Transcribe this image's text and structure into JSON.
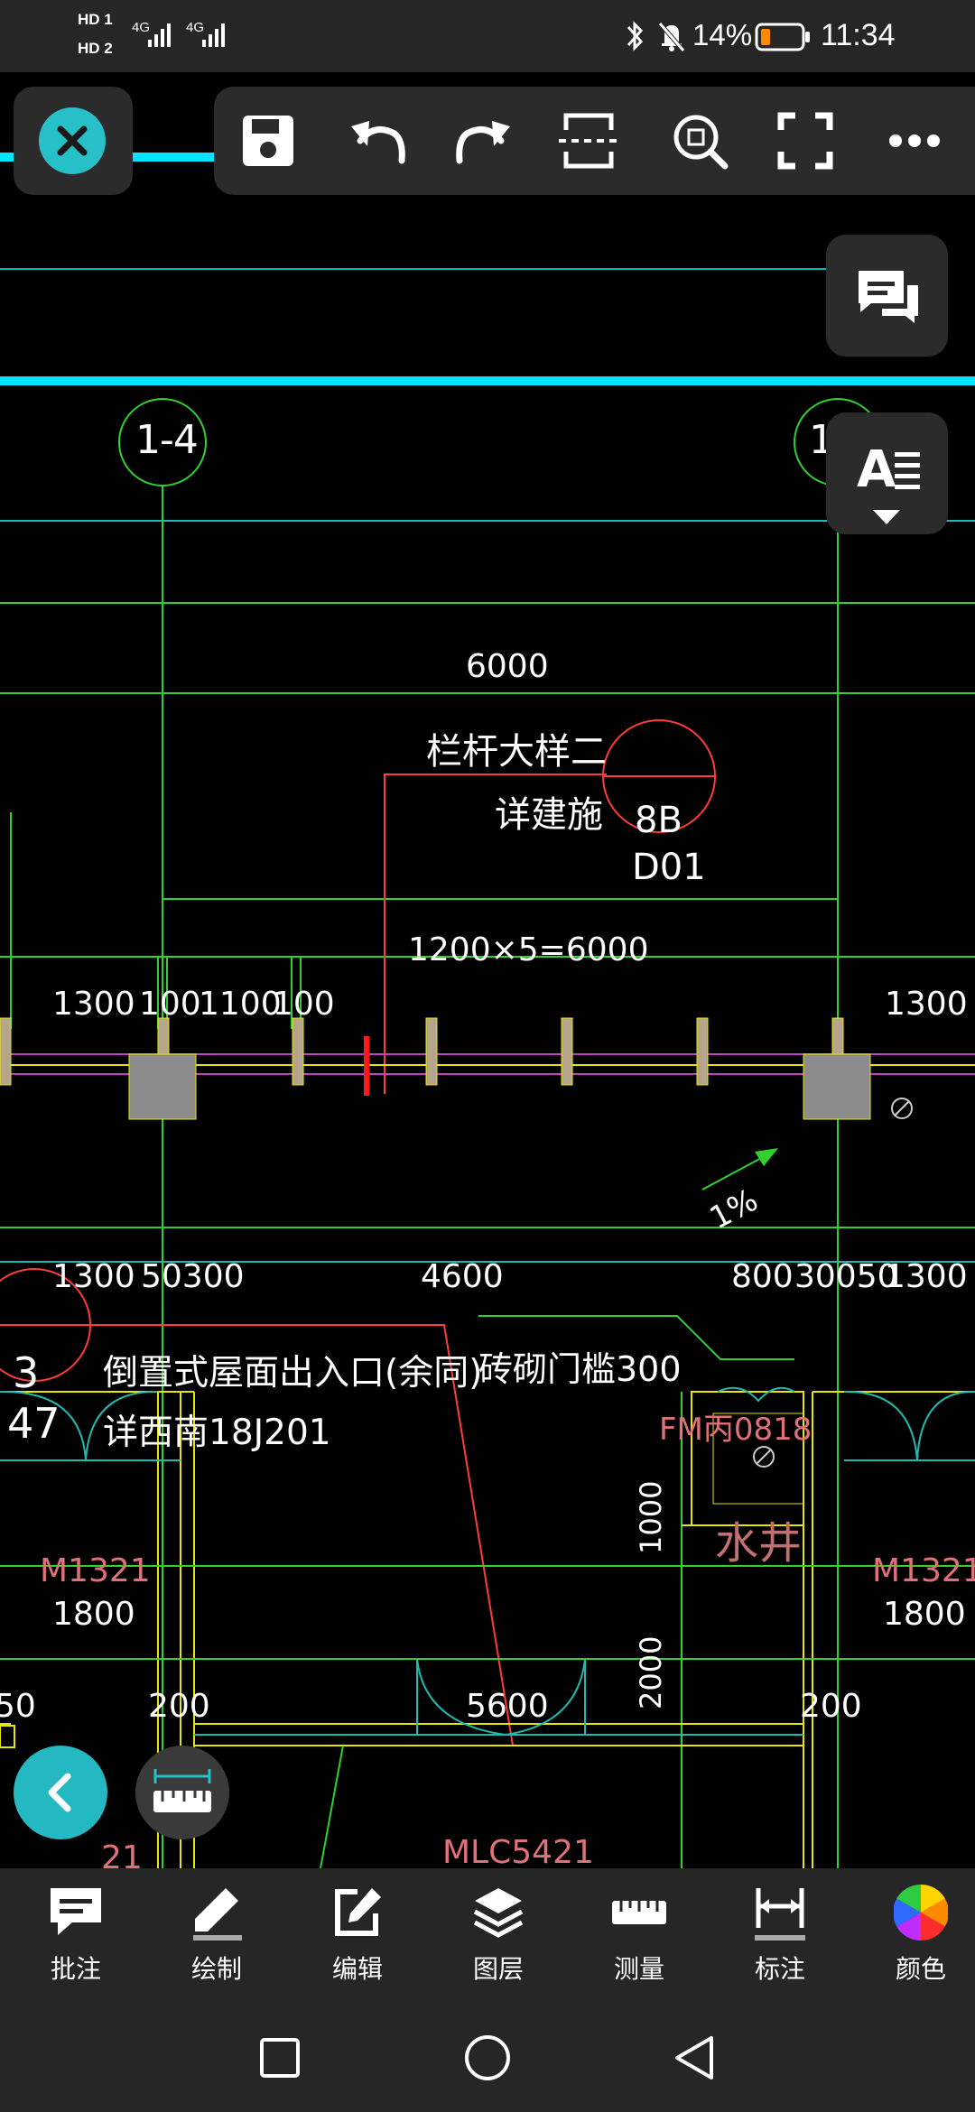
{
  "status": {
    "sim1": "HD 1",
    "sim2": "HD 2",
    "net1": "4G",
    "net2": "4G",
    "battery": "14%",
    "time": "11:34"
  },
  "toolbar": {
    "close": "close-icon",
    "items": [
      "save-icon",
      "undo-icon",
      "redo-icon",
      "select-region-icon",
      "zoom-fit-icon",
      "fullscreen-icon",
      "more-icon"
    ]
  },
  "drawing": {
    "axis_1": "1-4",
    "axis_2": "1",
    "dim_6000": "6000",
    "rail_note": "栏杆大样二",
    "rail_note2": "详建施",
    "ref_8b": "8B",
    "ref_d01": "D01",
    "dim_1200x5": "1200×5=6000",
    "dims_top": [
      "1300",
      "100",
      "1100",
      "100",
      "1300"
    ],
    "slope": "1%",
    "dims_mid": [
      "1300",
      "50300",
      "4600",
      "800",
      "30050",
      "1300"
    ],
    "ref_3": "3",
    "ref_47": "47",
    "exit_note": "倒置式屋面出入口(余同)",
    "exit_note2": "详西南18J201",
    "sill_note": "砖砌门槛300",
    "fm_label": "FM丙0818",
    "water_well": "水井",
    "dim_1000": "1000",
    "dim_2000": "2000",
    "m1321_left": "M1321",
    "m1321_left_w": "1800",
    "m1321_right": "M1321",
    "m1321_right_w": "1800",
    "dim_50": "50",
    "dim_200_left": "200",
    "dim_5600": "5600",
    "dim_200_right": "200",
    "mlc": "MLC5421",
    "partial_21": "21"
  },
  "bottom_nav": [
    {
      "label": "批注",
      "icon": "annotation-icon"
    },
    {
      "label": "绘制",
      "icon": "draw-pencil-icon"
    },
    {
      "label": "编辑",
      "icon": "edit-icon"
    },
    {
      "label": "图层",
      "icon": "layers-icon"
    },
    {
      "label": "测量",
      "icon": "ruler-icon"
    },
    {
      "label": "标注",
      "icon": "dimension-icon"
    },
    {
      "label": "颜色",
      "icon": "color-wheel-icon"
    }
  ],
  "colors": {
    "accent": "#27c0c8",
    "grid_green": "#2fd12f",
    "cad_white": "#ffffff",
    "cad_red": "#ff3b3b",
    "cad_cyan": "#00e5ff",
    "cad_yellow": "#e6e600"
  }
}
